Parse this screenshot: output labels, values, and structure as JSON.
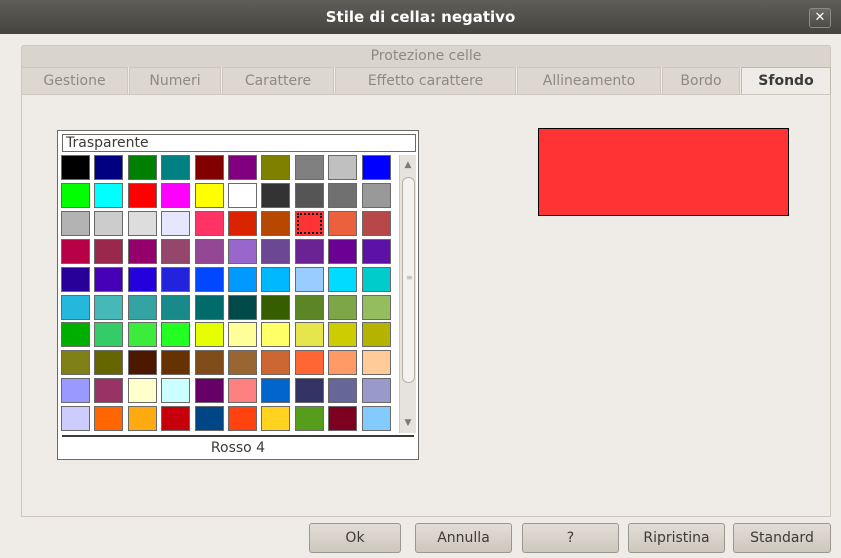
{
  "window": {
    "title": "Stile di cella: negativo",
    "close_glyph": "✕"
  },
  "tabs_row1": [
    {
      "label": "Protezione celle"
    }
  ],
  "tabs_row2": [
    {
      "label": "Gestione"
    },
    {
      "label": "Numeri"
    },
    {
      "label": "Carattere"
    },
    {
      "label": "Effetto carattere"
    },
    {
      "label": "Allineamento"
    },
    {
      "label": "Bordo"
    },
    {
      "label": "Sfondo",
      "active": true
    }
  ],
  "palette": {
    "transparent_label": "Trasparente",
    "selected_color_name": "Rosso 4",
    "selected_index": 27,
    "colors": [
      "#000000",
      "#000080",
      "#008000",
      "#008080",
      "#800000",
      "#800080",
      "#808000",
      "#808080",
      "#c0c0c0",
      "#0000ff",
      "#00ff00",
      "#00ffff",
      "#ff0000",
      "#ff00ff",
      "#ffff00",
      "#ffffff",
      "#333333",
      "#555555",
      "#707070",
      "#999999",
      "#b3b3b3",
      "#cccccc",
      "#dddddd",
      "#e6e6ff",
      "#ff3366",
      "#dc2300",
      "#b84700",
      "#ff3333",
      "#eb613d",
      "#b84747",
      "#b80047",
      "#99284c",
      "#94006b",
      "#94476b",
      "#944794",
      "#9966cc",
      "#6b4794",
      "#6b2394",
      "#6b0094",
      "#5e11a6",
      "#280099",
      "#4700b8",
      "#2300dc",
      "#2323dc",
      "#0047ff",
      "#0099ff",
      "#00b8ff",
      "#99ccff",
      "#00dcff",
      "#00cccc",
      "#23b8dc",
      "#47b8b8",
      "#33a3a3",
      "#198a8a",
      "#006b6b",
      "#004a4a",
      "#355e00",
      "#5c8526",
      "#7da647",
      "#94bd5e",
      "#00ae00",
      "#33cc66",
      "#3deb3d",
      "#23ff23",
      "#e6ff00",
      "#ffff99",
      "#ffff66",
      "#e6e64c",
      "#cccc00",
      "#b3b300",
      "#808019",
      "#666600",
      "#4c1900",
      "#663300",
      "#804c19",
      "#996633",
      "#cc6633",
      "#ff6633",
      "#ff9966",
      "#ffcc99",
      "#9999ff",
      "#993366",
      "#ffffcc",
      "#ccffff",
      "#660066",
      "#ff8080",
      "#0066cc",
      "#333366",
      "#666699",
      "#9999cc",
      "#ccccff",
      "#ff6600",
      "#ffaa11",
      "#c5000b",
      "#004586",
      "#ff420e",
      "#ffd320",
      "#579d1c",
      "#7e0021",
      "#83caff"
    ]
  },
  "preview_color": "#ff3333",
  "scrollbar": {
    "up_glyph": "▲",
    "down_glyph": "▼",
    "grip_glyph": "≡"
  },
  "buttons": {
    "ok": "Ok",
    "annulla": "Annulla",
    "help": "?",
    "ripristina": "Ripristina",
    "standard": "Standard"
  }
}
